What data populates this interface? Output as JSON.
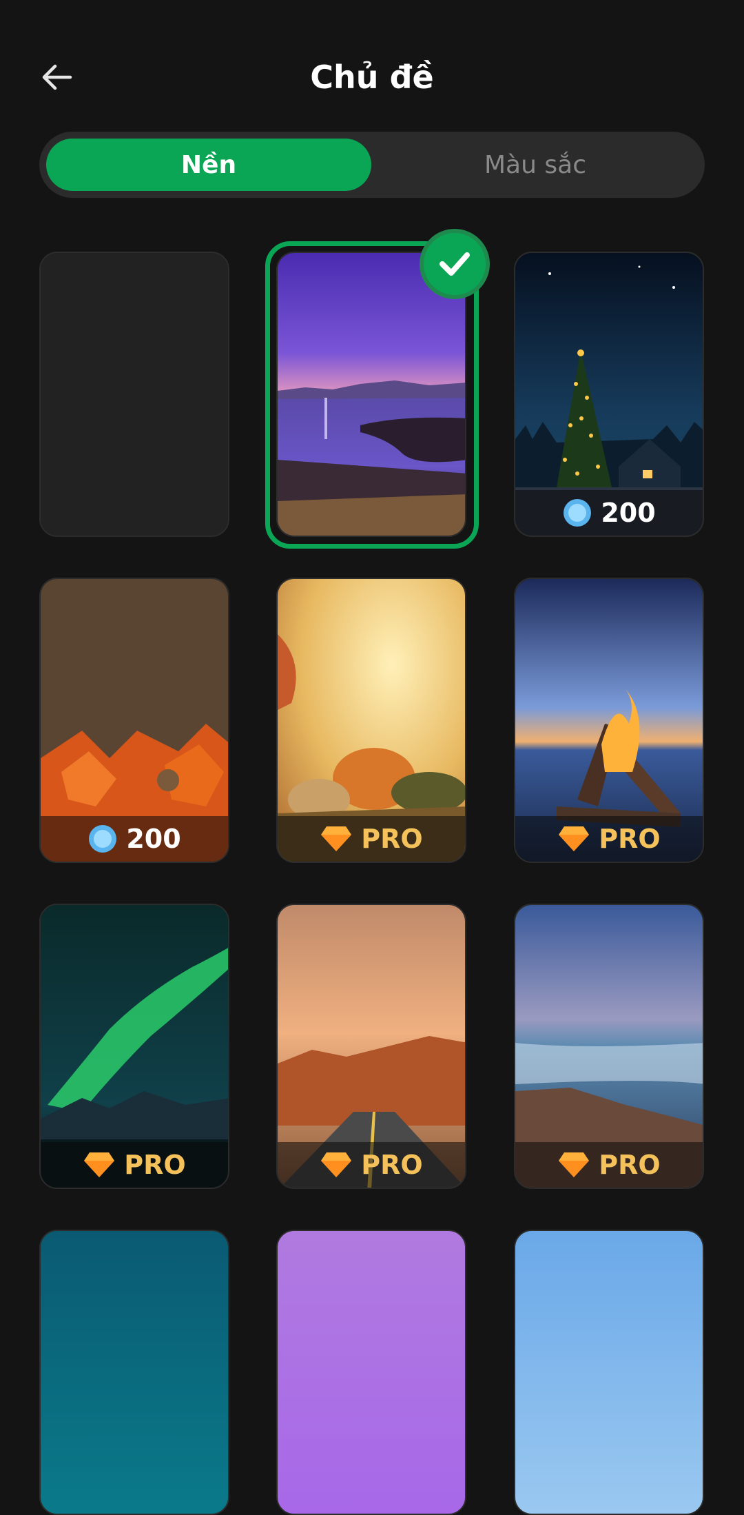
{
  "header": {
    "title": "Chủ đề",
    "back_icon": "arrow-left-icon"
  },
  "tabs": [
    {
      "label": "Nền",
      "active": true
    },
    {
      "label": "Màu sắc",
      "active": false
    }
  ],
  "colors": {
    "accent": "#0aa655",
    "pro": "#f4c15b",
    "background": "#141414"
  },
  "themes": [
    {
      "name": "blank",
      "badge": ""
    },
    {
      "name": "purple-lake-night",
      "badge": "",
      "selected": true
    },
    {
      "name": "christmas-tree",
      "badge_type": "coins",
      "badge": "200"
    },
    {
      "name": "autumn-leaves",
      "badge_type": "coins",
      "badge": "200"
    },
    {
      "name": "pumpkins",
      "badge_type": "pro",
      "badge": "PRO"
    },
    {
      "name": "campfire",
      "badge_type": "pro",
      "badge": "PRO"
    },
    {
      "name": "aurora",
      "badge_type": "pro",
      "badge": "PRO"
    },
    {
      "name": "desert-road",
      "badge_type": "pro",
      "badge": "PRO"
    },
    {
      "name": "rocky-shore",
      "badge_type": "pro",
      "badge": "PRO"
    },
    {
      "name": "teal",
      "badge": ""
    },
    {
      "name": "violet",
      "badge": ""
    },
    {
      "name": "sky-blue",
      "badge": ""
    }
  ]
}
